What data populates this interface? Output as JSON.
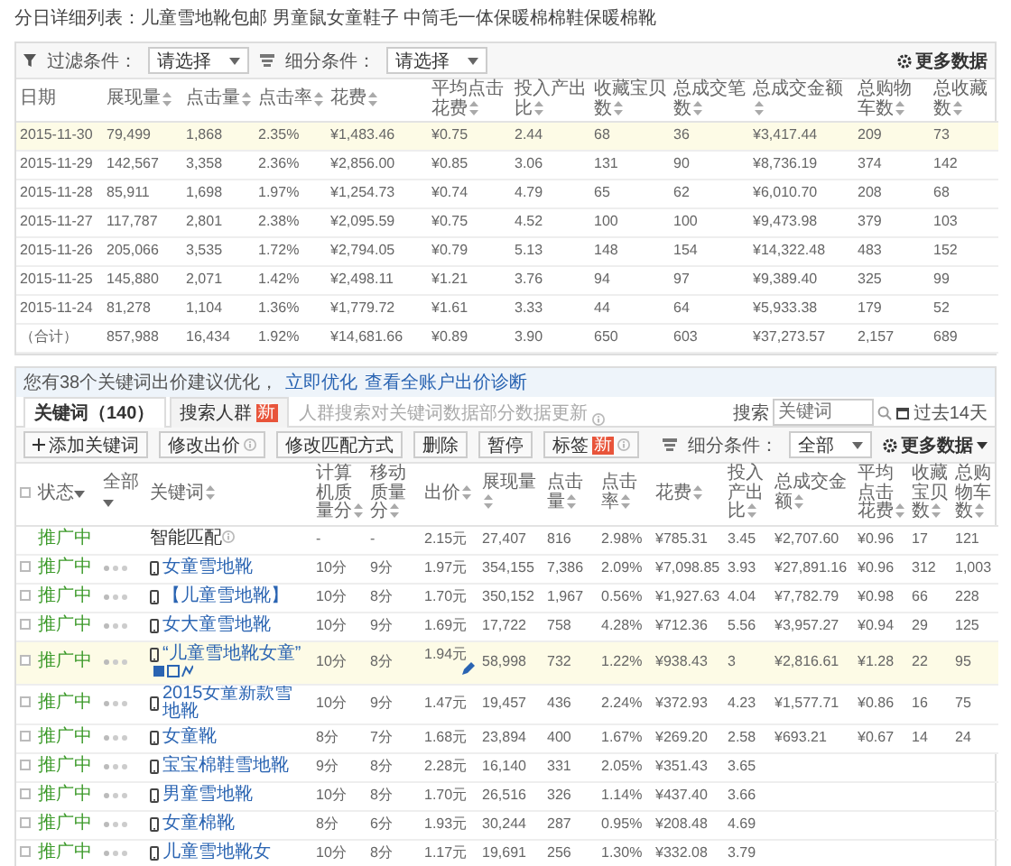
{
  "daily_report": {
    "title": "分日详细列表：儿童雪地靴包邮 男童鼠女童鞋子 中筒毛一体保暖棉棉鞋保暖棉靴",
    "filter": {
      "label": "过滤条件：",
      "value": "请选择"
    },
    "segment": {
      "label": "细分条件：",
      "value": "请选择"
    },
    "more_data": "更多数据",
    "columns": [
      {
        "label": "日期",
        "sortable": false
      },
      {
        "label": "展现量",
        "sortable": true
      },
      {
        "label": "点击量",
        "sortable": true
      },
      {
        "label": "点击率",
        "sortable": true
      },
      {
        "label": "花费",
        "sortable": true
      },
      {
        "label": "平均点击花费",
        "sortable": true
      },
      {
        "label": "投入产出比",
        "sortable": true
      },
      {
        "label": "收藏宝贝数",
        "sortable": true
      },
      {
        "label": "总成交笔数",
        "sortable": true
      },
      {
        "label": "总成交金额",
        "sortable": true
      },
      {
        "label": "总购物车数",
        "sortable": true
      },
      {
        "label": "总收藏数",
        "sortable": true
      }
    ],
    "rows": [
      {
        "highlighted": true,
        "cells": [
          "2015-11-30",
          "79,499",
          "1,868",
          "2.35%",
          "¥1,483.46",
          "¥0.75",
          "2.44",
          "68",
          "36",
          "¥3,417.44",
          "209",
          "73"
        ]
      },
      {
        "highlighted": false,
        "cells": [
          "2015-11-29",
          "142,567",
          "3,358",
          "2.36%",
          "¥2,856.00",
          "¥0.85",
          "3.06",
          "131",
          "90",
          "¥8,736.19",
          "374",
          "142"
        ]
      },
      {
        "highlighted": false,
        "cells": [
          "2015-11-28",
          "85,911",
          "1,698",
          "1.97%",
          "¥1,254.73",
          "¥0.74",
          "4.79",
          "65",
          "62",
          "¥6,010.70",
          "208",
          "68"
        ]
      },
      {
        "highlighted": false,
        "cells": [
          "2015-11-27",
          "117,787",
          "2,801",
          "2.38%",
          "¥2,095.59",
          "¥0.75",
          "4.52",
          "100",
          "100",
          "¥9,473.98",
          "379",
          "103"
        ]
      },
      {
        "highlighted": false,
        "cells": [
          "2015-11-26",
          "205,066",
          "3,535",
          "1.72%",
          "¥2,794.05",
          "¥0.79",
          "5.13",
          "148",
          "154",
          "¥14,322.48",
          "483",
          "152"
        ]
      },
      {
        "highlighted": false,
        "cells": [
          "2015-11-25",
          "145,880",
          "2,071",
          "1.42%",
          "¥2,498.11",
          "¥1.21",
          "3.76",
          "94",
          "97",
          "¥9,389.40",
          "325",
          "99"
        ]
      },
      {
        "highlighted": false,
        "cells": [
          "2015-11-24",
          "81,278",
          "1,104",
          "1.36%",
          "¥1,779.72",
          "¥1.61",
          "3.33",
          "44",
          "64",
          "¥5,933.38",
          "179",
          "52"
        ]
      },
      {
        "highlighted": false,
        "cells": [
          "（合计）",
          "857,988",
          "16,434",
          "1.92%",
          "¥14,681.66",
          "¥0.89",
          "3.90",
          "650",
          "603",
          "¥37,273.57",
          "2,157",
          "689"
        ]
      }
    ]
  },
  "keyword_panel": {
    "notice": {
      "text": "您有38个关键词出价建议优化，",
      "links": [
        "立即优化",
        "查看全账户出价诊断"
      ]
    },
    "tabs": [
      {
        "label": "关键词（140）",
        "selected": true
      },
      {
        "label": "搜索人群",
        "selected": false,
        "badge": "新"
      }
    ],
    "tab_note": "人群搜索对关键词数据部分数据更新",
    "toolbar": [
      {
        "label": "添加关键词",
        "kind": "add",
        "help": false
      },
      {
        "label": "修改出价",
        "kind": "plain",
        "help": true
      },
      {
        "label": "修改匹配方式",
        "kind": "plain",
        "help": false
      },
      {
        "label": "删除",
        "kind": "plain",
        "help": false
      },
      {
        "label": "暂停",
        "kind": "plain",
        "help": false
      },
      {
        "label": "标签",
        "kind": "plain",
        "help": true,
        "badge": "新"
      }
    ],
    "search": {
      "label": "搜索",
      "placeholder": "关键词"
    },
    "date_range": "过去14天",
    "segment": {
      "label": "细分条件：",
      "value": "全部"
    },
    "more_data": "更多数据",
    "select_all": {
      "checked": false
    },
    "fixed_columns": [
      {
        "label": "状态",
        "dropdown": true,
        "sortable": false
      },
      {
        "label": "全部",
        "dropdown": true,
        "sortable": false
      },
      {
        "label": "关键词",
        "dropdown": false,
        "sortable": true
      }
    ],
    "columns": [
      {
        "label": "计算机质量分",
        "dropdown": false,
        "sortable": true
      },
      {
        "label": "移动质量分",
        "dropdown": false,
        "sortable": true
      },
      {
        "label": "出价",
        "dropdown": false,
        "sortable": true
      },
      {
        "label": "展现量",
        "dropdown": false,
        "sortable": true
      },
      {
        "label": "点击量",
        "dropdown": false,
        "sortable": true
      },
      {
        "label": "点击率",
        "dropdown": false,
        "sortable": true
      },
      {
        "label": "花费",
        "dropdown": false,
        "sortable": true
      },
      {
        "label": "投入产出比",
        "dropdown": false,
        "sortable": true
      },
      {
        "label": "总成交金额",
        "dropdown": false,
        "sortable": true
      },
      {
        "label": "平均点击花费",
        "dropdown": false,
        "sortable": true
      },
      {
        "label": "收藏宝贝数",
        "dropdown": false,
        "sortable": true
      },
      {
        "label": "总购物车数",
        "dropdown": false,
        "sortable": true
      }
    ],
    "rows": [
      {
        "kind": "smart",
        "status": "推广中",
        "highlighted": false,
        "keyword": "智能匹配",
        "cells": [
          "-",
          "-",
          "2.15元",
          "27,407",
          "816",
          "2.98%",
          "¥785.31",
          "3.45",
          "¥2,707.60",
          "¥0.96",
          "17",
          "121"
        ]
      },
      {
        "kind": "keyword",
        "checked": false,
        "status": "推广中",
        "highlighted": false,
        "keyword": "女童雪地靴",
        "cells": [
          "10分",
          "9分",
          "1.97元",
          "354,155",
          "7,386",
          "2.09%",
          "¥7,098.85",
          "3.93",
          "¥27,891.16",
          "¥0.96",
          "312",
          "1,003"
        ]
      },
      {
        "kind": "keyword",
        "checked": false,
        "status": "推广中",
        "highlighted": false,
        "keyword": "【儿童雪地靴】",
        "cells": [
          "10分",
          "8分",
          "1.70元",
          "350,152",
          "1,967",
          "0.56%",
          "¥1,927.63",
          "4.04",
          "¥7,782.79",
          "¥0.98",
          "66",
          "228"
        ]
      },
      {
        "kind": "keyword",
        "checked": false,
        "status": "推广中",
        "highlighted": false,
        "keyword": "女大童雪地靴",
        "cells": [
          "10分",
          "9分",
          "1.69元",
          "17,722",
          "758",
          "4.28%",
          "¥712.36",
          "5.56",
          "¥3,957.27",
          "¥0.94",
          "29",
          "125"
        ]
      },
      {
        "kind": "keyword",
        "checked": false,
        "status": "推广中",
        "highlighted": true,
        "keyword": "“儿童雪地靴女童”",
        "cells": [
          "10分",
          "8分",
          "1.94元",
          "58,998",
          "732",
          "1.22%",
          "¥938.43",
          "3",
          "¥2,816.61",
          "¥1.28",
          "22",
          "95"
        ]
      },
      {
        "kind": "keyword",
        "checked": false,
        "status": "推广中",
        "highlighted": false,
        "keyword": "2015女童新款雪地靴",
        "cells": [
          "10分",
          "9分",
          "1.47元",
          "19,457",
          "436",
          "2.24%",
          "¥372.93",
          "4.23",
          "¥1,577.71",
          "¥0.86",
          "16",
          "75"
        ]
      },
      {
        "kind": "keyword",
        "checked": false,
        "status": "推广中",
        "highlighted": false,
        "keyword": "女童靴",
        "cells": [
          "8分",
          "7分",
          "1.68元",
          "23,894",
          "400",
          "1.67%",
          "¥269.20",
          "2.58",
          "¥693.21",
          "¥0.67",
          "14",
          "24"
        ]
      },
      {
        "kind": "keyword",
        "checked": false,
        "status": "推广中",
        "highlighted": false,
        "keyword": "宝宝棉鞋雪地靴",
        "cells": [
          "9分",
          "8分",
          "2.28元",
          "16,140",
          "331",
          "2.05%",
          "¥351.43",
          "3.65"
        ]
      },
      {
        "kind": "keyword",
        "checked": false,
        "status": "推广中",
        "highlighted": false,
        "keyword": "男童雪地靴",
        "cells": [
          "10分",
          "8分",
          "1.70元",
          "26,516",
          "326",
          "1.14%",
          "¥437.40",
          "3.66"
        ]
      },
      {
        "kind": "keyword",
        "checked": false,
        "status": "推广中",
        "highlighted": false,
        "keyword": "女童棉靴",
        "cells": [
          "8分",
          "6分",
          "1.93元",
          "30,244",
          "287",
          "0.95%",
          "¥208.48",
          "4.69"
        ]
      },
      {
        "kind": "keyword",
        "checked": false,
        "status": "推广中",
        "highlighted": false,
        "keyword": "儿童雪地靴女",
        "cells": [
          "10分",
          "8分",
          "1.17元",
          "19,691",
          "256",
          "1.30%",
          "¥332.08",
          "3.79"
        ]
      }
    ]
  }
}
